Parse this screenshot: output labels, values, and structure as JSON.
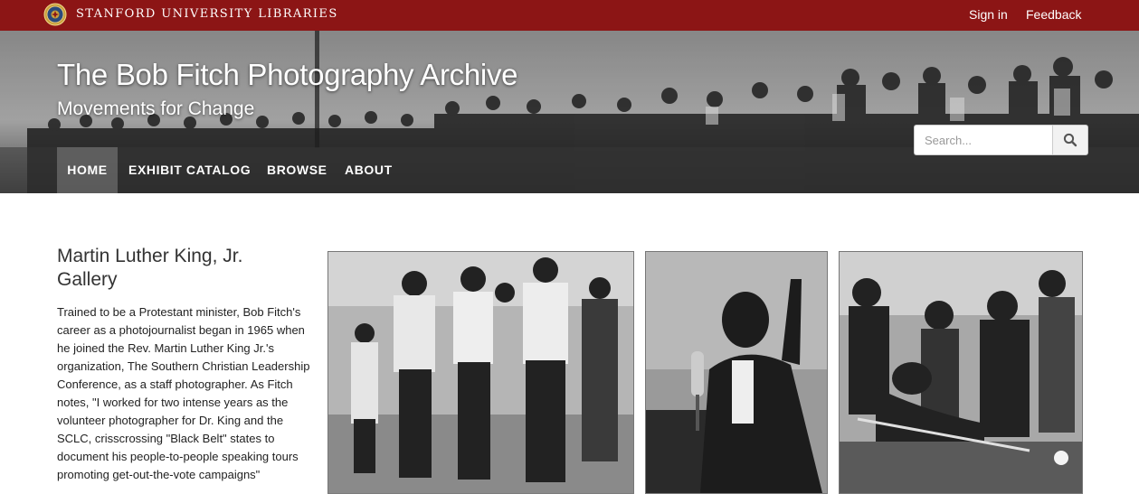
{
  "topbar": {
    "brand": "STANFORD UNIVERSITY LIBRARIES",
    "sign_in": "Sign in",
    "feedback": "Feedback",
    "logo_icon": "stanford-seal-icon",
    "background_color": "#8c1515"
  },
  "masthead": {
    "title": "The Bob Fitch Photography Archive",
    "subtitle": "Movements for Change"
  },
  "nav": {
    "items": [
      {
        "label": "HOME",
        "active": true
      },
      {
        "label": "EXHIBIT CATALOG",
        "active": false
      },
      {
        "label": "BROWSE",
        "active": false
      },
      {
        "label": "ABOUT",
        "active": false
      }
    ]
  },
  "search": {
    "placeholder": "Search...",
    "value": "",
    "button_icon": "search-icon"
  },
  "gallery": {
    "title": "Martin Luther King, Jr. Gallery",
    "description": "Trained to be a Protestant minister, Bob Fitch's career as a photojournalist began in 1965 when he joined the Rev. Martin Luther King Jr.'s organization, The Southern Christian Leadership Conference, as a staff photographer.  As Fitch notes, \"I worked for two intense years as the volunteer photographer for Dr. King and the SCLC, crisscrossing \"Black Belt\" states to document his people-to-people speaking tours promoting get-out-the-vote campaigns\""
  }
}
